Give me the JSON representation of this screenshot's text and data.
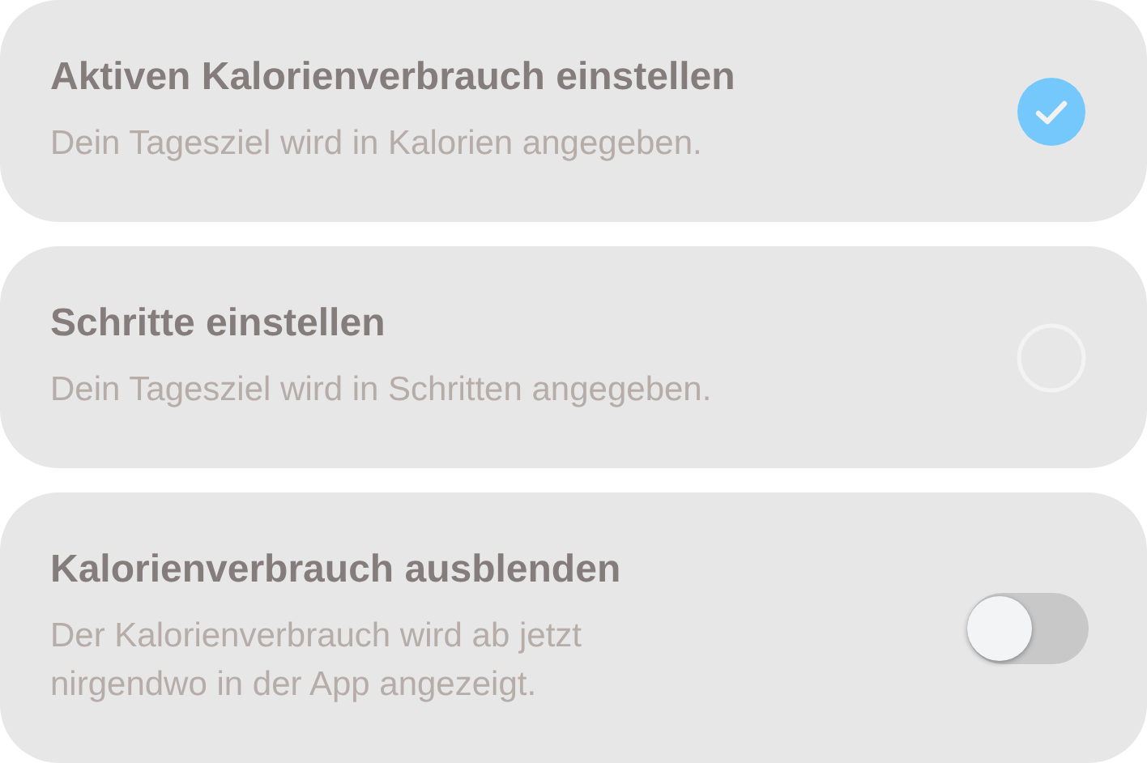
{
  "options": [
    {
      "kind": "radio",
      "title": "Aktiven Kalorienverbrauch einstellen",
      "description": "Dein Tagesziel wird in Kalorien angegeben.",
      "selected": true
    },
    {
      "kind": "radio",
      "title": "Schritte einstellen",
      "description": "Dein Tagesziel wird in Schritten angegeben.",
      "selected": false
    },
    {
      "kind": "toggle",
      "title": "Kalorienverbrauch ausblenden",
      "description": "Der Kalorienverbrauch wird ab jetzt\nnirgendwo in der App angezeigt.",
      "on": false
    }
  ]
}
